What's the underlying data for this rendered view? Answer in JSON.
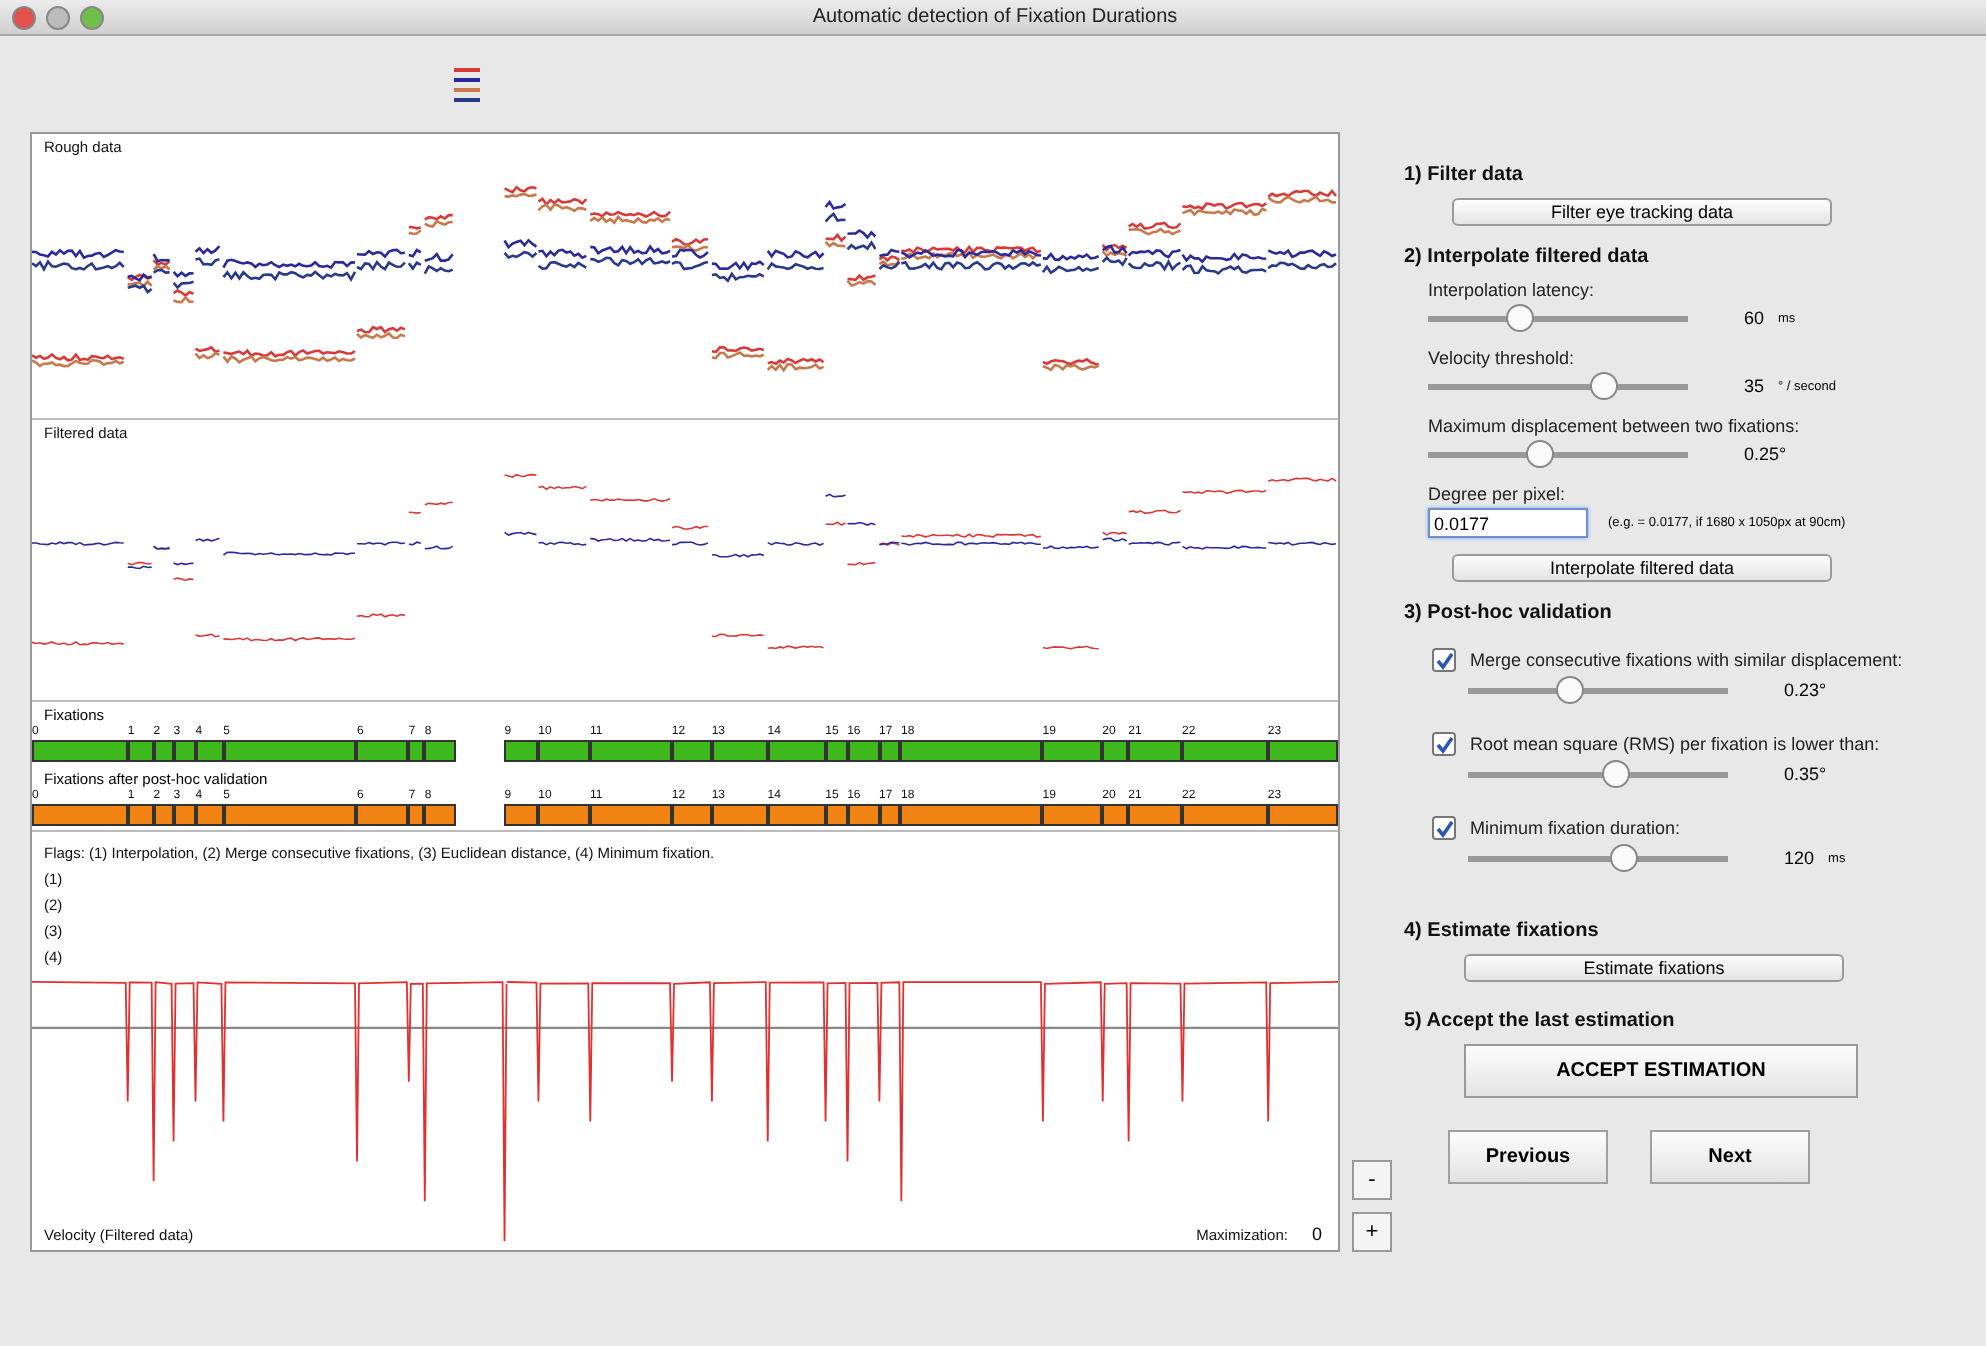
{
  "window": {
    "title": "Automatic detection of Fixation Durations"
  },
  "legend": [
    {
      "color": "#d83a3a"
    },
    {
      "color": "#2a2a9a"
    },
    {
      "color": "#c8784a"
    },
    {
      "color": "#2a3a8a"
    }
  ],
  "rough": {
    "title": "Rough data"
  },
  "filtered": {
    "title": "Filtered data"
  },
  "fixations": {
    "title": "Fixations",
    "segments": [
      "0",
      "1",
      "2",
      "3",
      "4",
      "5",
      "6",
      "7",
      "8",
      "9",
      "10",
      "11",
      "12",
      "13",
      "14",
      "15",
      "16",
      "17",
      "18",
      "19",
      "20",
      "21",
      "22",
      "23"
    ]
  },
  "validated": {
    "title": "Fixations after post-hoc validation",
    "segments": [
      "0",
      "1",
      "2",
      "3",
      "4",
      "5",
      "6",
      "7",
      "8",
      "9",
      "10",
      "11",
      "12",
      "13",
      "14",
      "15",
      "16",
      "17",
      "18",
      "19",
      "20",
      "21",
      "22",
      "23"
    ]
  },
  "flags": {
    "legend": "Flags: (1) Interpolation, (2) Merge consecutive fixations, (3) Euclidean distance, (4)  Minimum fixation.",
    "rows": [
      "(1)",
      "(2)",
      "(3)",
      "(4)"
    ]
  },
  "velocity": {
    "title": "Velocity (Filtered data)",
    "maximization_label": "Maximization:",
    "maximization_value": "0"
  },
  "zoom_buttons": [
    "-",
    "+"
  ],
  "filter": {
    "title": "1) Filter data",
    "button": "Filter eye tracking data"
  },
  "interpolate": {
    "title": "2) Interpolate filtered data",
    "sliders": [
      {
        "label": "Interpolation latency:",
        "level": 0.35,
        "value": "60",
        "unit": "ms"
      },
      {
        "label": "Velocity threshold:",
        "level": 0.68,
        "value": "35",
        "unit": "° / second"
      },
      {
        "label": "Maximum displacement between two fixations:",
        "level": 0.43,
        "value": "0.25°"
      }
    ],
    "field": {
      "label": "Degree per pixel:",
      "value": "0.0177",
      "hint": "(e.g. = 0.0177, if 1680 x 1050px at 90cm)"
    },
    "button": "Interpolate filtered data"
  },
  "validation": {
    "title": "3) Post-hoc validation",
    "checks": [
      {
        "label": "Merge consecutive fixations with similar displacement:",
        "checked": true,
        "level": 0.39,
        "value": "0.23°"
      },
      {
        "label": "Root mean square (RMS) per fixation is lower than:",
        "checked": true,
        "level": 0.57,
        "value": "0.35°"
      },
      {
        "label": "Minimum fixation duration:",
        "checked": true,
        "level": 0.6,
        "value": "120",
        "unit": "ms"
      }
    ]
  },
  "estimate": {
    "title": "4) Estimate fixations",
    "button": "Estimate fixations"
  },
  "accept": {
    "title": "5) Accept the last estimation",
    "button": "ACCEPT ESTIMATION"
  },
  "nav": [
    "Previous",
    "Next"
  ]
}
